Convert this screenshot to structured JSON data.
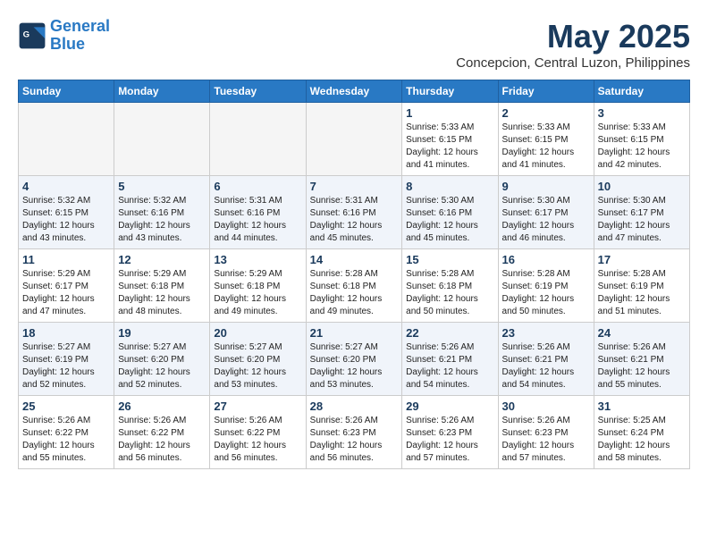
{
  "logo": {
    "line1": "General",
    "line2": "Blue"
  },
  "title": "May 2025",
  "location": "Concepcion, Central Luzon, Philippines",
  "weekdays": [
    "Sunday",
    "Monday",
    "Tuesday",
    "Wednesday",
    "Thursday",
    "Friday",
    "Saturday"
  ],
  "weeks": [
    [
      {
        "day": "",
        "info": ""
      },
      {
        "day": "",
        "info": ""
      },
      {
        "day": "",
        "info": ""
      },
      {
        "day": "",
        "info": ""
      },
      {
        "day": "1",
        "info": "Sunrise: 5:33 AM\nSunset: 6:15 PM\nDaylight: 12 hours\nand 41 minutes."
      },
      {
        "day": "2",
        "info": "Sunrise: 5:33 AM\nSunset: 6:15 PM\nDaylight: 12 hours\nand 41 minutes."
      },
      {
        "day": "3",
        "info": "Sunrise: 5:33 AM\nSunset: 6:15 PM\nDaylight: 12 hours\nand 42 minutes."
      }
    ],
    [
      {
        "day": "4",
        "info": "Sunrise: 5:32 AM\nSunset: 6:15 PM\nDaylight: 12 hours\nand 43 minutes."
      },
      {
        "day": "5",
        "info": "Sunrise: 5:32 AM\nSunset: 6:16 PM\nDaylight: 12 hours\nand 43 minutes."
      },
      {
        "day": "6",
        "info": "Sunrise: 5:31 AM\nSunset: 6:16 PM\nDaylight: 12 hours\nand 44 minutes."
      },
      {
        "day": "7",
        "info": "Sunrise: 5:31 AM\nSunset: 6:16 PM\nDaylight: 12 hours\nand 45 minutes."
      },
      {
        "day": "8",
        "info": "Sunrise: 5:30 AM\nSunset: 6:16 PM\nDaylight: 12 hours\nand 45 minutes."
      },
      {
        "day": "9",
        "info": "Sunrise: 5:30 AM\nSunset: 6:17 PM\nDaylight: 12 hours\nand 46 minutes."
      },
      {
        "day": "10",
        "info": "Sunrise: 5:30 AM\nSunset: 6:17 PM\nDaylight: 12 hours\nand 47 minutes."
      }
    ],
    [
      {
        "day": "11",
        "info": "Sunrise: 5:29 AM\nSunset: 6:17 PM\nDaylight: 12 hours\nand 47 minutes."
      },
      {
        "day": "12",
        "info": "Sunrise: 5:29 AM\nSunset: 6:18 PM\nDaylight: 12 hours\nand 48 minutes."
      },
      {
        "day": "13",
        "info": "Sunrise: 5:29 AM\nSunset: 6:18 PM\nDaylight: 12 hours\nand 49 minutes."
      },
      {
        "day": "14",
        "info": "Sunrise: 5:28 AM\nSunset: 6:18 PM\nDaylight: 12 hours\nand 49 minutes."
      },
      {
        "day": "15",
        "info": "Sunrise: 5:28 AM\nSunset: 6:18 PM\nDaylight: 12 hours\nand 50 minutes."
      },
      {
        "day": "16",
        "info": "Sunrise: 5:28 AM\nSunset: 6:19 PM\nDaylight: 12 hours\nand 50 minutes."
      },
      {
        "day": "17",
        "info": "Sunrise: 5:28 AM\nSunset: 6:19 PM\nDaylight: 12 hours\nand 51 minutes."
      }
    ],
    [
      {
        "day": "18",
        "info": "Sunrise: 5:27 AM\nSunset: 6:19 PM\nDaylight: 12 hours\nand 52 minutes."
      },
      {
        "day": "19",
        "info": "Sunrise: 5:27 AM\nSunset: 6:20 PM\nDaylight: 12 hours\nand 52 minutes."
      },
      {
        "day": "20",
        "info": "Sunrise: 5:27 AM\nSunset: 6:20 PM\nDaylight: 12 hours\nand 53 minutes."
      },
      {
        "day": "21",
        "info": "Sunrise: 5:27 AM\nSunset: 6:20 PM\nDaylight: 12 hours\nand 53 minutes."
      },
      {
        "day": "22",
        "info": "Sunrise: 5:26 AM\nSunset: 6:21 PM\nDaylight: 12 hours\nand 54 minutes."
      },
      {
        "day": "23",
        "info": "Sunrise: 5:26 AM\nSunset: 6:21 PM\nDaylight: 12 hours\nand 54 minutes."
      },
      {
        "day": "24",
        "info": "Sunrise: 5:26 AM\nSunset: 6:21 PM\nDaylight: 12 hours\nand 55 minutes."
      }
    ],
    [
      {
        "day": "25",
        "info": "Sunrise: 5:26 AM\nSunset: 6:22 PM\nDaylight: 12 hours\nand 55 minutes."
      },
      {
        "day": "26",
        "info": "Sunrise: 5:26 AM\nSunset: 6:22 PM\nDaylight: 12 hours\nand 56 minutes."
      },
      {
        "day": "27",
        "info": "Sunrise: 5:26 AM\nSunset: 6:22 PM\nDaylight: 12 hours\nand 56 minutes."
      },
      {
        "day": "28",
        "info": "Sunrise: 5:26 AM\nSunset: 6:23 PM\nDaylight: 12 hours\nand 56 minutes."
      },
      {
        "day": "29",
        "info": "Sunrise: 5:26 AM\nSunset: 6:23 PM\nDaylight: 12 hours\nand 57 minutes."
      },
      {
        "day": "30",
        "info": "Sunrise: 5:26 AM\nSunset: 6:23 PM\nDaylight: 12 hours\nand 57 minutes."
      },
      {
        "day": "31",
        "info": "Sunrise: 5:25 AM\nSunset: 6:24 PM\nDaylight: 12 hours\nand 58 minutes."
      }
    ]
  ]
}
